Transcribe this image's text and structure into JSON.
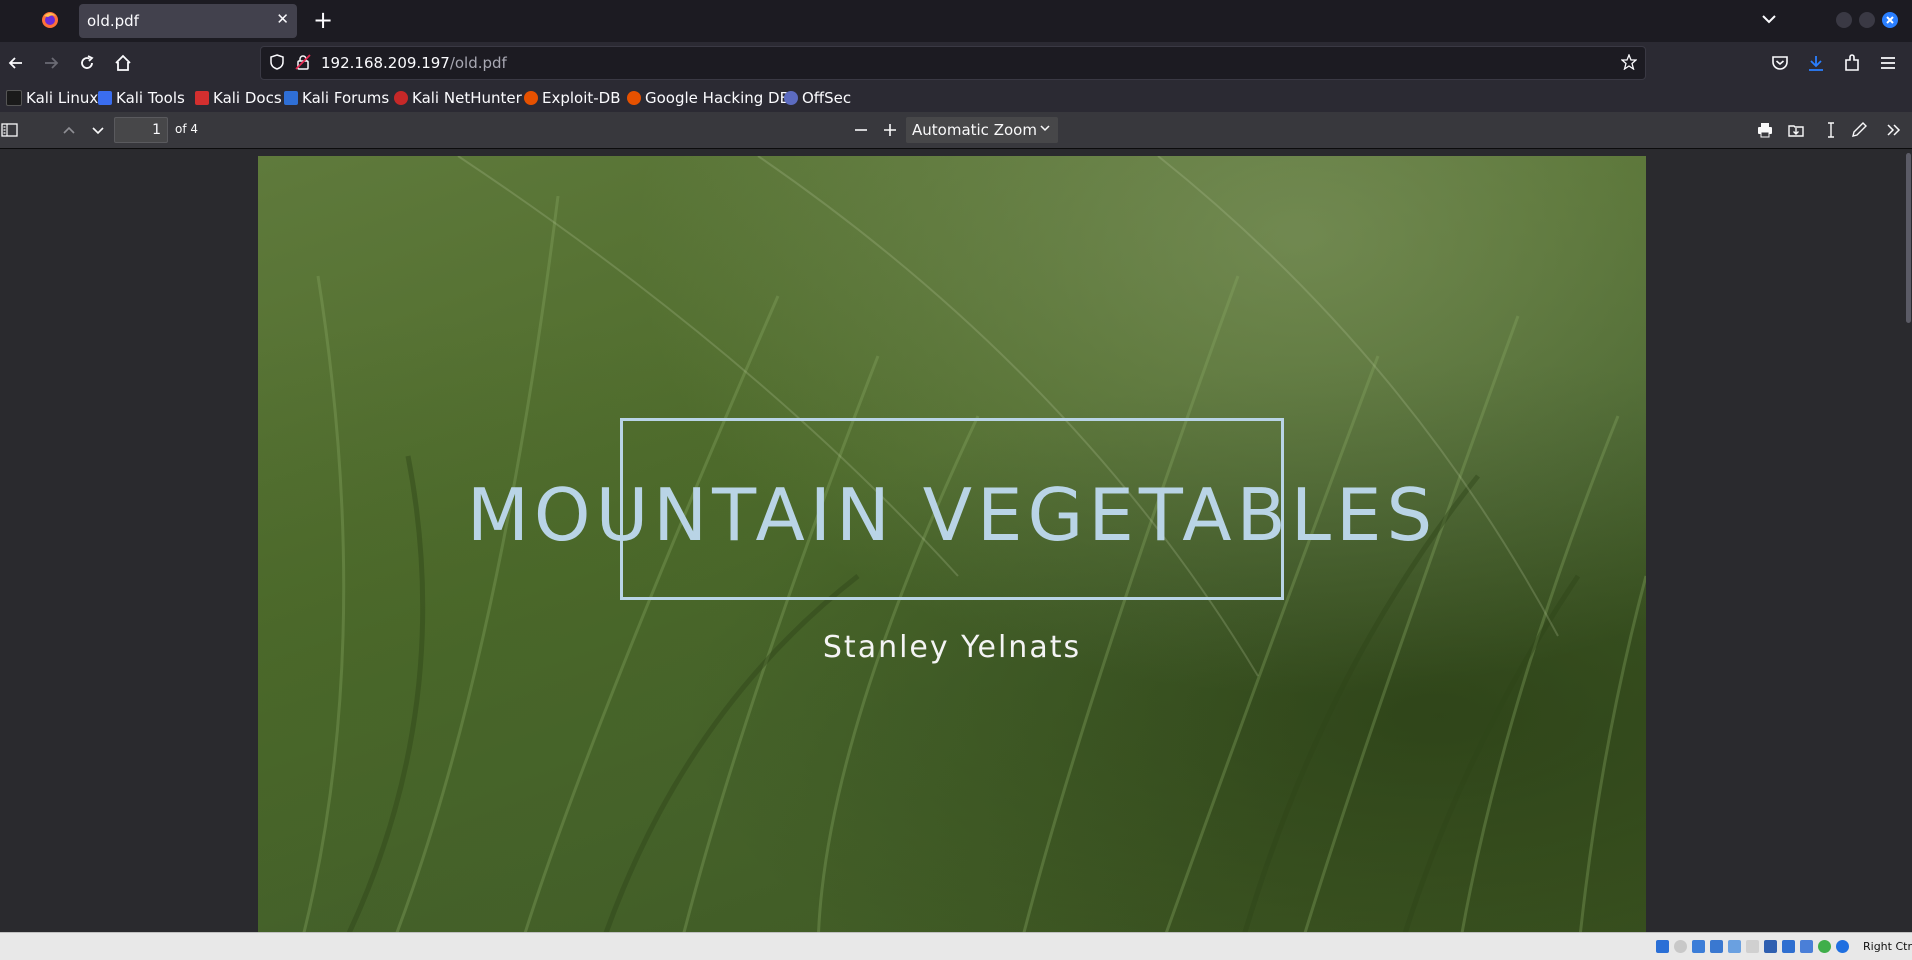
{
  "browser": {
    "tab_title": "old.pdf",
    "url_host": "192.168.209.197",
    "url_path": "/old.pdf",
    "accent": "#2a7fff"
  },
  "bookmarks": [
    {
      "label": "Kali Linux",
      "icon": "kali-dragon-icon"
    },
    {
      "label": "Kali Tools",
      "icon": "kali-tools-icon"
    },
    {
      "label": "Kali Docs",
      "icon": "kali-docs-icon"
    },
    {
      "label": "Kali Forums",
      "icon": "kali-forums-icon"
    },
    {
      "label": "Kali NetHunter",
      "icon": "nethunter-icon"
    },
    {
      "label": "Exploit-DB",
      "icon": "exploit-db-icon"
    },
    {
      "label": "Google Hacking DB",
      "icon": "ghdb-icon"
    },
    {
      "label": "OffSec",
      "icon": "offsec-icon"
    }
  ],
  "pdf_toolbar": {
    "page_number": "1",
    "page_count_label": "of 4",
    "zoom_label": "Automatic Zoom"
  },
  "document": {
    "title": "MOUNTAIN VEGETABLES",
    "author": "Stanley Yelnats",
    "title_color": "#b9d4e6"
  },
  "statusbar": {
    "host_key": "Right Ctrl"
  }
}
